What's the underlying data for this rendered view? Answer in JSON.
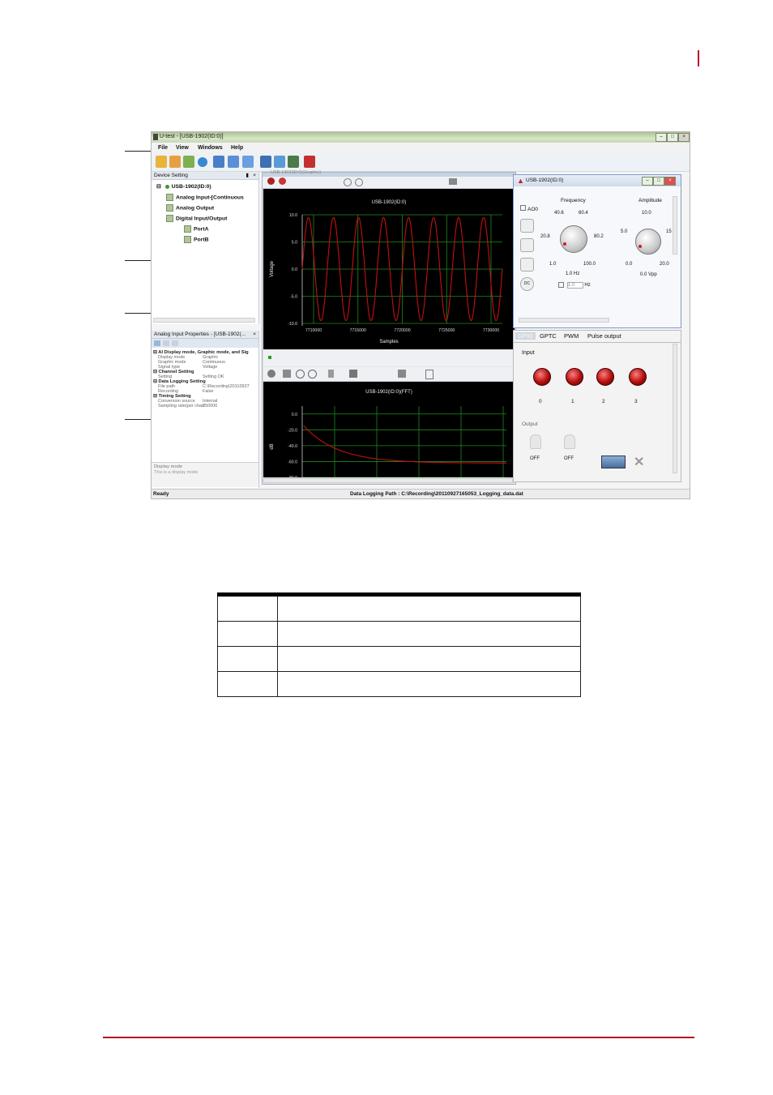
{
  "app": {
    "title": "U-test - [USB-1902(ID:0)]",
    "menu": [
      "File",
      "View",
      "Windows",
      "Help"
    ],
    "device_setting": {
      "title": "Device Setting",
      "tree": [
        "USB-1902(ID:0)",
        "Analog Input-[Continuous",
        "Analog Output",
        "Digital Input/Output",
        "PortA",
        "PortB"
      ]
    },
    "properties": {
      "title": "Analog Input Properties - [USB-1902(...",
      "groups": [
        {
          "name": "AI Display mode, Graphic mode, and Sig",
          "rows": [
            [
              "Display mode",
              "Graphic"
            ],
            [
              "Graphic mode",
              "Continuous"
            ],
            [
              "Signal type",
              "Voltage"
            ]
          ]
        },
        {
          "name": "Channel Setting",
          "rows": [
            [
              "Setting",
              "Setting OK"
            ]
          ]
        },
        {
          "name": "Data Logging Setting",
          "rows": [
            [
              "File path",
              "C:\\Recording\\20110927"
            ],
            [
              "Recording",
              "False"
            ]
          ]
        },
        {
          "name": "Timing Setting",
          "rows": [
            [
              "Conversion source",
              "Internal"
            ],
            [
              "Sampling rate(per chan",
              "250000"
            ]
          ]
        }
      ],
      "desc_title": "Display mode",
      "desc_text": "This is a display mode"
    },
    "graph_pane_title": "USB-1902(ID:0)(Graphic)",
    "status": {
      "left": "Ready",
      "center": "Data Logging Path : C:\\Recording\\20110927165053_Logging_data.dat"
    }
  },
  "chart_data": [
    {
      "type": "line",
      "title": "USB-1902(ID:0)",
      "xlabel": "Samples",
      "ylabel": "Voltage",
      "x_ticks": [
        "7710000",
        "7715000",
        "7720000",
        "7725000",
        "7730000"
      ],
      "y_ticks": [
        "10.0",
        "5.0",
        "0.0",
        "-5.0",
        "-10.0"
      ],
      "ylim": [
        -10,
        10
      ],
      "series": [
        {
          "shape": "sine",
          "cycles": 8,
          "amplitude": 9.5,
          "color": "#c41010"
        }
      ],
      "grid": true
    },
    {
      "type": "line",
      "title": "USB-1902(ID:0)(FFT)",
      "ylabel": "dB",
      "y_ticks": [
        "0.0",
        "-20.0",
        "-40.0",
        "-60.0",
        "-80.0"
      ],
      "ylim": [
        -80,
        10
      ],
      "series": [
        {
          "shape": "decay",
          "start_db": -15,
          "end_db": -62,
          "color": "#c41010"
        }
      ],
      "grid": true
    }
  ],
  "ao_panel": {
    "title": "USB-1902(ID:0)",
    "channel": "AO0",
    "frequency": {
      "label": "Frequency",
      "ticks": [
        "40.6",
        "60.4",
        "20.8",
        "80.2",
        "1.0",
        "100.0"
      ],
      "readout": "1.0 Hz",
      "input_value": "1.0",
      "unit": "Hz"
    },
    "amplitude": {
      "label": "Amplitude",
      "ticks": [
        "10.0",
        "5.0",
        "15",
        "0.0",
        "20.0"
      ],
      "readout": "0.0 Vpp"
    }
  },
  "dio_panel": {
    "tabs": [
      "GPIO",
      "GPTC",
      "PWM",
      "Pulse output"
    ],
    "input_label": "Input",
    "input_leds": [
      "0",
      "1",
      "2",
      "3"
    ],
    "output_label": "Output",
    "outputs": [
      "OFF",
      "OFF"
    ]
  },
  "colors": {
    "accent_red": "#c0102a",
    "plot_bg": "#000000",
    "grid": "#1f8a1f",
    "signal": "#c41010"
  }
}
